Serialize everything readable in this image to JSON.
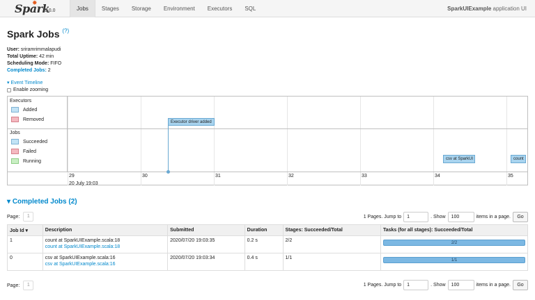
{
  "nav": {
    "logo_text": "Spark",
    "version": "3.0.0",
    "tabs": [
      {
        "label": "Jobs",
        "active": true
      },
      {
        "label": "Stages",
        "active": false
      },
      {
        "label": "Storage",
        "active": false
      },
      {
        "label": "Environment",
        "active": false
      },
      {
        "label": "Executors",
        "active": false
      },
      {
        "label": "SQL",
        "active": false
      }
    ],
    "app_name": "SparkUIExample",
    "app_suffix": "application UI"
  },
  "page": {
    "title": "Spark Jobs",
    "help": "(?)"
  },
  "summary": {
    "user_label": "User:",
    "user": "sriramrimmalapudi",
    "uptime_label": "Total Uptime:",
    "uptime": "42 min",
    "scheduling_label": "Scheduling Mode:",
    "scheduling": "FIFO",
    "completed_label": "Completed Jobs:",
    "completed": "2"
  },
  "timeline": {
    "toggle": "Event Timeline",
    "zoom_label": "Enable zooming",
    "executors_group": "Executors",
    "executors_legend": [
      "Added",
      "Removed"
    ],
    "jobs_group": "Jobs",
    "jobs_legend": [
      "Succeeded",
      "Failed",
      "Running"
    ],
    "ticks": [
      "29",
      "30",
      "31",
      "32",
      "33",
      "34",
      "35"
    ],
    "date": "20 July 19:03",
    "executor_event": "Executor driver added",
    "job_events": [
      "csv at SparkUI",
      "count"
    ]
  },
  "completed_jobs": {
    "title": "Completed Jobs (2)",
    "pager": {
      "page_label": "Page:",
      "page": "1",
      "pages_text": "1 Pages. Jump to",
      "jump_value": "1",
      "show_label": ". Show",
      "show_value": "100",
      "items_text": "items in a page.",
      "go": "Go"
    },
    "columns": [
      "Job Id ▾",
      "Description",
      "Submitted",
      "Duration",
      "Stages: Succeeded/Total",
      "Tasks (for all stages): Succeeded/Total"
    ],
    "rows": [
      {
        "id": "1",
        "desc": "count at SparkUIExample.scala:18",
        "desc_link": "count at SparkUIExample.scala:18",
        "submitted": "2020/07/20 19:03:35",
        "duration": "0.2 s",
        "stages": "2/2",
        "tasks": "2/2",
        "task_fraction": 1.0
      },
      {
        "id": "0",
        "desc": "csv at SparkUIExample.scala:16",
        "desc_link": "csv at SparkUIExample.scala:16",
        "submitted": "2020/07/20 19:03:34",
        "duration": "0.4 s",
        "stages": "1/1",
        "tasks": "1/1",
        "task_fraction": 1.0
      }
    ]
  }
}
